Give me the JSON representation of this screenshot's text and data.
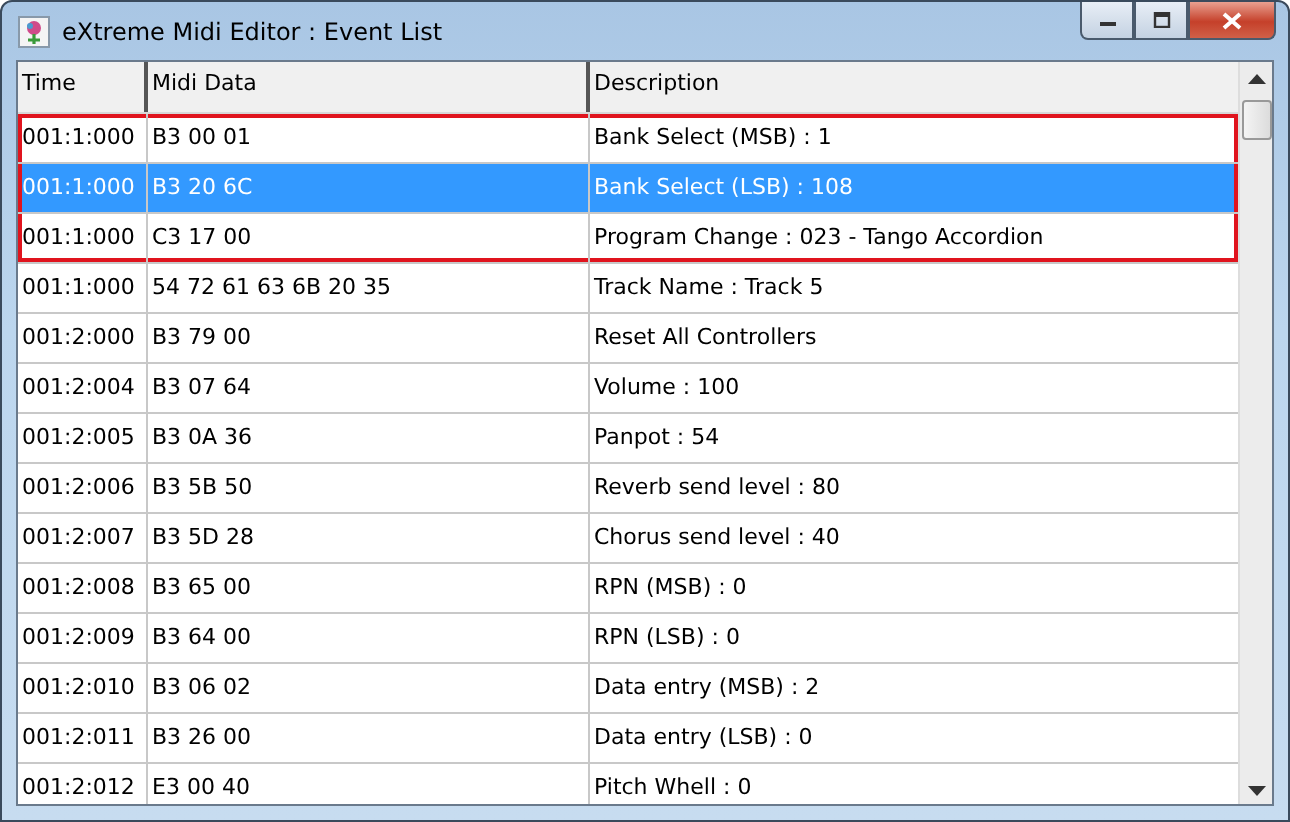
{
  "window": {
    "title": "eXtreme Midi Editor : Event List"
  },
  "table": {
    "columns": [
      "Time",
      "Midi Data",
      "Description"
    ],
    "rows": [
      {
        "cells": [
          "001:1:000",
          "B3 00 01",
          "Bank Select (MSB) : 1"
        ],
        "selected": false,
        "outlined": true
      },
      {
        "cells": [
          "001:1:000",
          "B3 20 6C",
          "Bank Select (LSB) : 108"
        ],
        "selected": true,
        "outlined": true
      },
      {
        "cells": [
          "001:1:000",
          "C3 17 00",
          "Program Change : 023 - Tango Accordion"
        ],
        "selected": false,
        "outlined": true
      },
      {
        "cells": [
          "001:1:000",
          "54 72 61 63 6B 20 35",
          "Track Name : Track 5"
        ],
        "selected": false,
        "outlined": false
      },
      {
        "cells": [
          "001:2:000",
          "B3 79 00",
          "Reset All Controllers"
        ],
        "selected": false,
        "outlined": false
      },
      {
        "cells": [
          "001:2:004",
          "B3 07 64",
          "Volume : 100"
        ],
        "selected": false,
        "outlined": false
      },
      {
        "cells": [
          "001:2:005",
          "B3 0A 36",
          "Panpot : 54"
        ],
        "selected": false,
        "outlined": false
      },
      {
        "cells": [
          "001:2:006",
          "B3 5B 50",
          "Reverb send level : 80"
        ],
        "selected": false,
        "outlined": false
      },
      {
        "cells": [
          "001:2:007",
          "B3 5D 28",
          "Chorus send level : 40"
        ],
        "selected": false,
        "outlined": false
      },
      {
        "cells": [
          "001:2:008",
          "B3 65 00",
          "RPN (MSB) : 0"
        ],
        "selected": false,
        "outlined": false
      },
      {
        "cells": [
          "001:2:009",
          "B3 64 00",
          "RPN (LSB) : 0"
        ],
        "selected": false,
        "outlined": false
      },
      {
        "cells": [
          "001:2:010",
          "B3 06 02",
          "Data entry (MSB) : 2"
        ],
        "selected": false,
        "outlined": false
      },
      {
        "cells": [
          "001:2:011",
          "B3 26 00",
          "Data entry (LSB) : 0"
        ],
        "selected": false,
        "outlined": false
      },
      {
        "cells": [
          "001:2:012",
          "E3 00 40",
          "Pitch Whell : 0"
        ],
        "selected": false,
        "outlined": false
      }
    ]
  }
}
